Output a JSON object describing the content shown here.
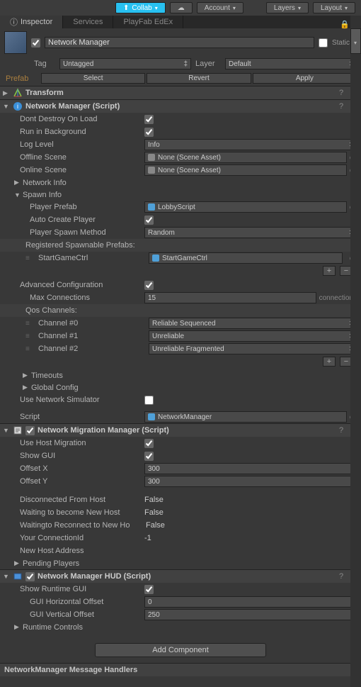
{
  "toolbar": {
    "collab": "Collab",
    "account": "Account",
    "layers": "Layers",
    "layout": "Layout"
  },
  "tabs": {
    "inspector": "Inspector",
    "services": "Services",
    "playfab": "PlayFab EdEx"
  },
  "header": {
    "objectName": "Network Manager",
    "staticLabel": "Static",
    "tagLabel": "Tag",
    "tagValue": "Untagged",
    "layerLabel": "Layer",
    "layerValue": "Default",
    "prefabLabel": "Prefab",
    "selectBtn": "Select",
    "revertBtn": "Revert",
    "applyBtn": "Apply"
  },
  "transform": {
    "title": "Transform"
  },
  "networkManager": {
    "title": "Network Manager (Script)",
    "dontDestroy": {
      "label": "Dont Destroy On Load"
    },
    "runInBg": {
      "label": "Run in Background"
    },
    "logLevel": {
      "label": "Log Level",
      "value": "Info"
    },
    "offlineScene": {
      "label": "Offline Scene",
      "value": "None (Scene Asset)"
    },
    "onlineScene": {
      "label": "Online Scene",
      "value": "None (Scene Asset)"
    },
    "networkInfo": "Network Info",
    "spawnInfo": "Spawn Info",
    "playerPrefab": {
      "label": "Player Prefab",
      "value": "LobbyScript"
    },
    "autoCreate": {
      "label": "Auto Create Player"
    },
    "spawnMethod": {
      "label": "Player Spawn Method",
      "value": "Random"
    },
    "regPrefabs": "Registered Spawnable Prefabs:",
    "startGame": {
      "label": "StartGameCtrl",
      "value": "StartGameCtrl"
    },
    "advConfig": {
      "label": "Advanced Configuration"
    },
    "maxConn": {
      "label": "Max Connections",
      "value": "15",
      "unit": "connections"
    },
    "qosChannels": "Qos Channels:",
    "channel0": {
      "label": "Channel #0",
      "value": "Reliable Sequenced"
    },
    "channel1": {
      "label": "Channel #1",
      "value": "Unreliable"
    },
    "channel2": {
      "label": "Channel #2",
      "value": "Unreliable Fragmented"
    },
    "timeouts": "Timeouts",
    "globalConfig": "Global Config",
    "useNetSim": {
      "label": "Use Network Simulator"
    },
    "script": {
      "label": "Script",
      "value": "NetworkManager"
    }
  },
  "migrationManager": {
    "title": "Network Migration Manager (Script)",
    "useHostMig": {
      "label": "Use Host Migration"
    },
    "showGui": {
      "label": "Show GUI"
    },
    "offsetX": {
      "label": "Offset X",
      "value": "300"
    },
    "offsetY": {
      "label": "Offset Y",
      "value": "300"
    },
    "disconnected": {
      "label": "Disconnected From Host",
      "value": "False"
    },
    "waitingNew": {
      "label": "Waiting to become New Host",
      "value": "False"
    },
    "waitingReconnect": {
      "label": "Waitingto Reconnect to New Ho",
      "value": "False"
    },
    "connId": {
      "label": "Your ConnectionId",
      "value": "-1"
    },
    "newHostAddr": {
      "label": "New Host Address",
      "value": ""
    },
    "pendingPlayers": "Pending Players"
  },
  "hud": {
    "title": "Network Manager HUD (Script)",
    "showRuntime": {
      "label": "Show Runtime GUI"
    },
    "hOffset": {
      "label": "GUI Horizontal Offset",
      "value": "0"
    },
    "vOffset": {
      "label": "GUI Vertical Offset",
      "value": "250"
    },
    "runtimeControls": "Runtime Controls"
  },
  "addComponent": "Add Component",
  "footer": "NetworkManager Message Handlers"
}
